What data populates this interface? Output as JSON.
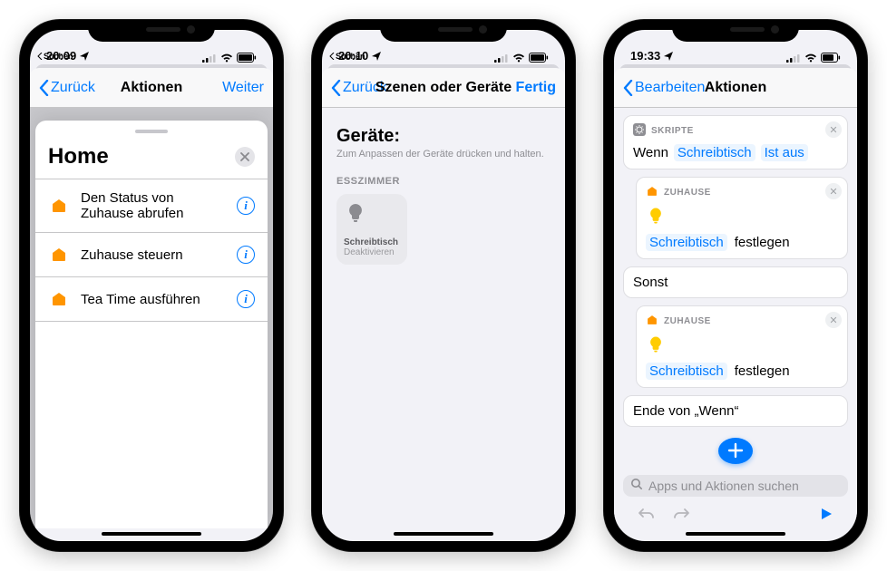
{
  "phone1": {
    "status": {
      "time": "20:09",
      "back_app": "Suchen"
    },
    "nav": {
      "back": "Zurück",
      "title": "Aktionen",
      "right": "Weiter"
    },
    "sheet": {
      "title": "Home",
      "items": [
        {
          "label": "Den Status von Zuhause abrufen"
        },
        {
          "label": "Zuhause steuern"
        },
        {
          "label": "Tea Time ausführen"
        }
      ]
    }
  },
  "phone2": {
    "status": {
      "time": "20:10",
      "back_app": "Suchen"
    },
    "nav": {
      "back": "Zurück",
      "title": "Szenen oder Geräte",
      "right": "Fertig"
    },
    "heading": "Geräte:",
    "subtitle": "Zum Anpassen der Geräte drücken und halten.",
    "group": "ESSZIMMER",
    "device": {
      "name": "Schreibtisch",
      "state": "Deaktivieren"
    }
  },
  "phone3": {
    "status": {
      "time": "19:33"
    },
    "nav": {
      "back": "Bearbeiten",
      "title": "Aktionen"
    },
    "scripts_label": "SKRIPTE",
    "if": {
      "kw": "Wenn",
      "var": "Schreibtisch",
      "cond": "Ist aus"
    },
    "home_label": "ZUHAUSE",
    "action": {
      "target": "Schreibtisch",
      "verb": "festlegen"
    },
    "else": "Sonst",
    "endif": "Ende von „Wenn“",
    "search_placeholder": "Apps und Aktionen suchen"
  }
}
